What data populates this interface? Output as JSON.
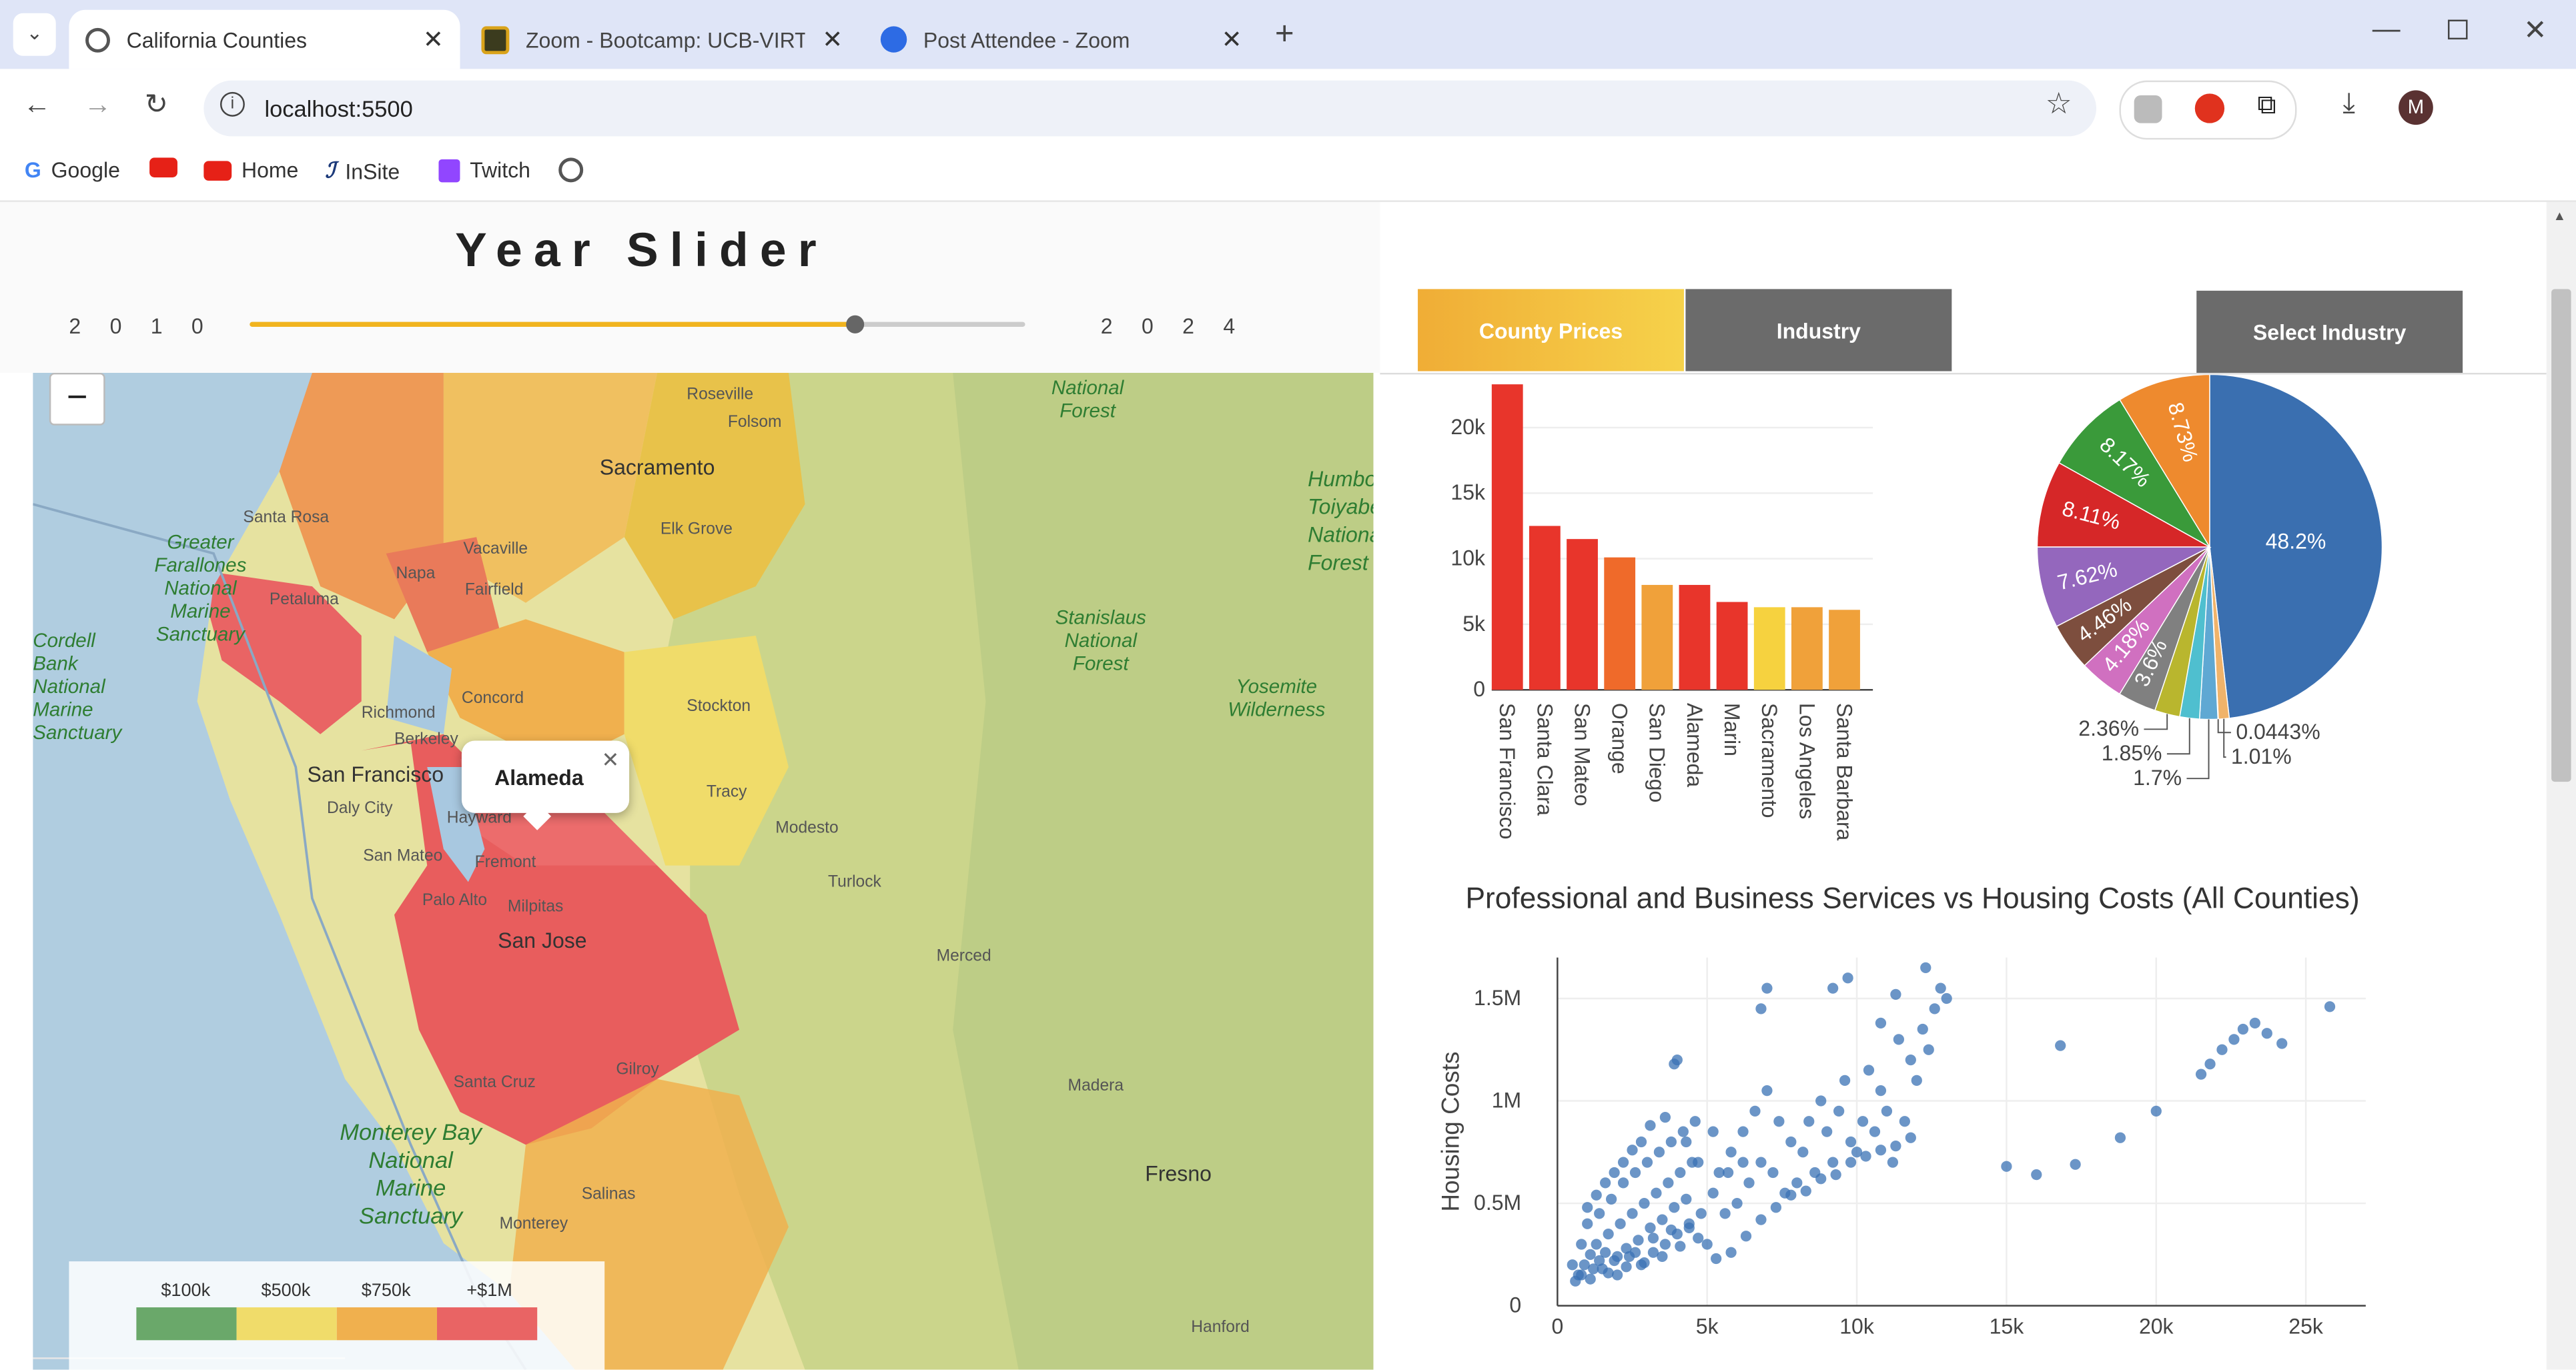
{
  "browser": {
    "tabs": [
      {
        "title": "California Counties",
        "active": true
      },
      {
        "title": "Zoom - Bootcamp: UCB-VIRT-D",
        "active": false
      },
      {
        "title": "Post Attendee - Zoom",
        "active": false
      }
    ],
    "url": "localhost:5500",
    "profile_initial": "M",
    "bookmarks": [
      "Google",
      "Home",
      "InSite",
      "Twitch"
    ]
  },
  "slider": {
    "title": "Year Slider",
    "min_label": "2 0 1 0",
    "max_label": "2 0 2 4",
    "min": 2010,
    "max": 2024,
    "value_fraction": 0.78
  },
  "map": {
    "popup": "Alameda",
    "places": [
      "Roseville",
      "Folsom",
      "Sacramento",
      "Santa Rosa",
      "Vacaville",
      "Napa",
      "Elk Grove",
      "Fairfield",
      "Petaluma",
      "Richmond",
      "Concord",
      "Stockton",
      "Berkeley",
      "San Francisco",
      "Daly City",
      "Hayward",
      "Tracy",
      "Modesto",
      "Fremont",
      "San Mateo",
      "Milpitas",
      "Palo Alto",
      "San Jose",
      "Turlock",
      "Merced",
      "Santa Cruz",
      "Gilroy",
      "Madera",
      "Fresno",
      "Salinas",
      "Hanford",
      "Monterey"
    ],
    "areas": [
      "Greater Farallones National Marine Sanctuary",
      "Cordell Bank National Marine Sanctuary",
      "Stanislaus National Forest",
      "Yosemite Wilderness",
      "Monterey Bay National Marine Sanctuary",
      "National Forest",
      "Humboldt-Toiyabe National Forest"
    ],
    "legend": [
      {
        "label": "$100k",
        "color": "#6aa86a"
      },
      {
        "label": "$500k",
        "color": "#f0dc6a"
      },
      {
        "label": "$750k",
        "color": "#f0b04e"
      },
      {
        "label": "+$1M",
        "color": "#e96464"
      }
    ]
  },
  "buttons": {
    "county_prices": "County Prices",
    "industry": "Industry",
    "select_industry": "Select Industry"
  },
  "chart_data": [
    {
      "type": "bar",
      "categories": [
        "San Francisco",
        "Santa Clara",
        "San Mateo",
        "Orange",
        "San Diego",
        "Alameda",
        "Marin",
        "Sacramento",
        "Los Angeles",
        "Santa Barbara"
      ],
      "values": [
        23300,
        12500,
        11500,
        10100,
        8000,
        8000,
        6700,
        6300,
        6300,
        6100
      ],
      "colors": [
        "#e8352b",
        "#e8352b",
        "#e8352b",
        "#ef6a2a",
        "#f0a13a",
        "#e8352b",
        "#e8352b",
        "#f6d23f",
        "#f0a13a",
        "#f0a13a"
      ],
      "ylim": [
        0,
        23300
      ],
      "yticks": [
        "0",
        "5k",
        "10k",
        "15k",
        "20k"
      ],
      "ytick_values": [
        0,
        5000,
        10000,
        15000,
        20000
      ],
      "title": "",
      "xlabel": "",
      "ylabel": ""
    },
    {
      "type": "pie",
      "slices": [
        {
          "value": 48.2,
          "label": "48.2%",
          "color": "#3a6fb0"
        },
        {
          "value": 1.01,
          "label": "1.01%",
          "color": "#f0b36a"
        },
        {
          "value": 0.0443,
          "label": "0.0443%",
          "color": "#9ecae1"
        },
        {
          "value": 1.7,
          "label": "1.7%",
          "color": "#5fa8d3"
        },
        {
          "value": 1.85,
          "label": "1.85%",
          "color": "#4fbfcf"
        },
        {
          "value": 2.36,
          "label": "2.36%",
          "color": "#b9b62e"
        },
        {
          "value": 3.6,
          "label": "3.6%",
          "color": "#808080"
        },
        {
          "value": 4.18,
          "label": "4.18%",
          "color": "#d070c0"
        },
        {
          "value": 4.46,
          "label": "4.46%",
          "color": "#7d4e3e"
        },
        {
          "value": 7.62,
          "label": "7.62%",
          "color": "#9467bd"
        },
        {
          "value": 8.11,
          "label": "8.11%",
          "color": "#d62728"
        },
        {
          "value": 8.17,
          "label": "8.17%",
          "color": "#3a9a3a"
        },
        {
          "value": 8.73,
          "label": "8.73%",
          "color": "#ee8a2e"
        }
      ]
    },
    {
      "type": "scatter",
      "title": "Professional and Business Services vs Housing Costs (All Counties)",
      "ylabel": "Housing Costs",
      "xlabel": "",
      "xlim": [
        0,
        27000
      ],
      "ylim": [
        0,
        1700000
      ],
      "xticks": [
        "0",
        "5k",
        "10k",
        "15k",
        "20k",
        "25k"
      ],
      "xtick_values": [
        0,
        5000,
        10000,
        15000,
        20000,
        25000
      ],
      "yticks": [
        "0",
        "0.5M",
        "1M",
        "1.5M"
      ],
      "ytick_values": [
        0,
        500000,
        1000000,
        1500000
      ],
      "color": "#3a72b4",
      "points": [
        [
          700,
          150000
        ],
        [
          900,
          200000
        ],
        [
          1100,
          250000
        ],
        [
          1300,
          300000
        ],
        [
          1500,
          180000
        ],
        [
          1700,
          350000
        ],
        [
          1900,
          220000
        ],
        [
          2100,
          400000
        ],
        [
          2300,
          280000
        ],
        [
          2500,
          450000
        ],
        [
          2700,
          320000
        ],
        [
          2900,
          500000
        ],
        [
          3100,
          380000
        ],
        [
          3300,
          550000
        ],
        [
          3500,
          420000
        ],
        [
          3700,
          600000
        ],
        [
          3900,
          480000
        ],
        [
          4100,
          650000
        ],
        [
          4300,
          520000
        ],
        [
          4500,
          700000
        ],
        [
          800,
          300000
        ],
        [
          1000,
          400000
        ],
        [
          1200,
          180000
        ],
        [
          1400,
          450000
        ],
        [
          1600,
          260000
        ],
        [
          1800,
          520000
        ],
        [
          2000,
          150000
        ],
        [
          2200,
          600000
        ],
        [
          2400,
          240000
        ],
        [
          2600,
          650000
        ],
        [
          2800,
          200000
        ],
        [
          3000,
          700000
        ],
        [
          3200,
          260000
        ],
        [
          3400,
          750000
        ],
        [
          3600,
          300000
        ],
        [
          3800,
          800000
        ],
        [
          4000,
          350000
        ],
        [
          4200,
          850000
        ],
        [
          4400,
          400000
        ],
        [
          4600,
          900000
        ],
        [
          4800,
          450000
        ],
        [
          5000,
          300000
        ],
        [
          5200,
          550000
        ],
        [
          5400,
          650000
        ],
        [
          5600,
          450000
        ],
        [
          5800,
          750000
        ],
        [
          6000,
          500000
        ],
        [
          6200,
          850000
        ],
        [
          6400,
          600000
        ],
        [
          6600,
          950000
        ],
        [
          6800,
          700000
        ],
        [
          7000,
          1050000
        ],
        [
          7200,
          650000
        ],
        [
          7400,
          900000
        ],
        [
          7600,
          550000
        ],
        [
          7800,
          800000
        ],
        [
          8000,
          600000
        ],
        [
          8200,
          750000
        ],
        [
          8400,
          900000
        ],
        [
          8600,
          650000
        ],
        [
          8800,
          1000000
        ],
        [
          9000,
          850000
        ],
        [
          9200,
          700000
        ],
        [
          9400,
          950000
        ],
        [
          9600,
          1100000
        ],
        [
          9800,
          800000
        ],
        [
          10000,
          750000
        ],
        [
          10200,
          900000
        ],
        [
          10400,
          1150000
        ],
        [
          10600,
          850000
        ],
        [
          10800,
          1050000
        ],
        [
          11000,
          950000
        ],
        [
          11200,
          700000
        ],
        [
          11400,
          1300000
        ],
        [
          11600,
          900000
        ],
        [
          11800,
          1200000
        ],
        [
          12000,
          1100000
        ],
        [
          12200,
          1350000
        ],
        [
          12400,
          1250000
        ],
        [
          12600,
          1450000
        ],
        [
          12800,
          1550000
        ],
        [
          13000,
          1500000
        ],
        [
          7000,
          1550000
        ],
        [
          6800,
          1450000
        ],
        [
          9200,
          1550000
        ],
        [
          9700,
          1600000
        ],
        [
          10800,
          1380000
        ],
        [
          11300,
          1520000
        ],
        [
          12300,
          1650000
        ],
        [
          4000,
          1200000
        ],
        [
          3900,
          1180000
        ],
        [
          3600,
          920000
        ],
        [
          3100,
          880000
        ],
        [
          2800,
          800000
        ],
        [
          2500,
          760000
        ],
        [
          2200,
          700000
        ],
        [
          1900,
          650000
        ],
        [
          1600,
          600000
        ],
        [
          1300,
          540000
        ],
        [
          1000,
          480000
        ],
        [
          500,
          200000
        ],
        [
          600,
          120000
        ],
        [
          800,
          150000
        ],
        [
          1100,
          130000
        ],
        [
          1400,
          220000
        ],
        [
          1700,
          160000
        ],
        [
          2000,
          240000
        ],
        [
          2300,
          190000
        ],
        [
          2600,
          260000
        ],
        [
          2900,
          210000
        ],
        [
          3200,
          330000
        ],
        [
          3500,
          240000
        ],
        [
          3800,
          370000
        ],
        [
          4100,
          290000
        ],
        [
          4400,
          380000
        ],
        [
          4700,
          330000
        ],
        [
          5300,
          230000
        ],
        [
          5800,
          260000
        ],
        [
          6300,
          340000
        ],
        [
          6800,
          420000
        ],
        [
          7300,
          480000
        ],
        [
          7800,
          540000
        ],
        [
          8300,
          560000
        ],
        [
          8800,
          620000
        ],
        [
          9300,
          640000
        ],
        [
          9800,
          700000
        ],
        [
          10300,
          730000
        ],
        [
          10800,
          760000
        ],
        [
          11300,
          780000
        ],
        [
          11800,
          820000
        ],
        [
          16800,
          1270000
        ],
        [
          15000,
          680000
        ],
        [
          16000,
          640000
        ],
        [
          17300,
          690000
        ],
        [
          18800,
          820000
        ],
        [
          20000,
          950000
        ],
        [
          21500,
          1130000
        ],
        [
          21800,
          1180000
        ],
        [
          22200,
          1250000
        ],
        [
          22600,
          1300000
        ],
        [
          22900,
          1350000
        ],
        [
          23300,
          1380000
        ],
        [
          23700,
          1330000
        ],
        [
          24200,
          1280000
        ],
        [
          25800,
          1460000
        ],
        [
          4300,
          800000
        ],
        [
          4700,
          700000
        ],
        [
          5200,
          850000
        ],
        [
          5700,
          650000
        ],
        [
          6200,
          700000
        ]
      ]
    }
  ]
}
